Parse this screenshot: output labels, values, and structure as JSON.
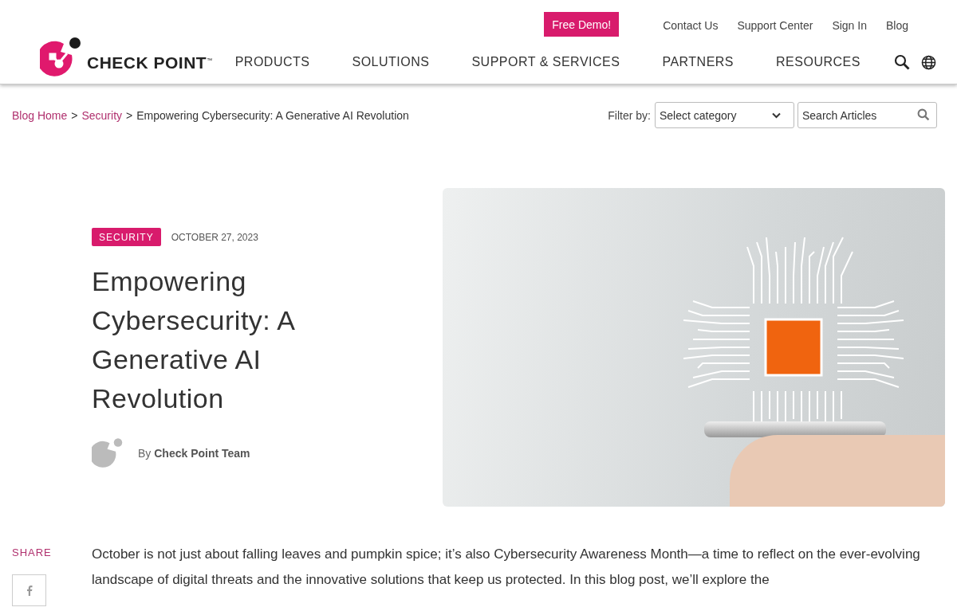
{
  "header": {
    "logo": "CHECK POINT$^{™}$",
    "demo_button": "Free Demo!",
    "top_links": [
      "Contact Us",
      "Support Center",
      "Sign In",
      "Blog"
    ],
    "nav": [
      "PRODUCTS",
      "SOLUTIONS",
      "SUPPORT & SERVICES",
      "PARTNERS",
      "RESOURCES"
    ]
  },
  "breadcrumb": {
    "separator": ">",
    "items": [
      {
        "label": "Blog Home",
        "link": true
      },
      {
        "label": "Security",
        "link": true
      },
      {
        "label": "Empowering Cybersecurity: A Generative AI Revolution",
        "link": false
      }
    ]
  },
  "filter": {
    "label": "Filter by:",
    "category_placeholder": "Select category",
    "search_placeholder": "Search Articles"
  },
  "article": {
    "category": "SECURITY",
    "date": "OCTOBER 27, 2023",
    "title": "Empowering Cybersecurity: A Generative AI Revolution",
    "byline_prefix": "By",
    "author": "Check Point Team",
    "share_label": "SHARE",
    "body": "October is not just about falling leaves and pumpkin spice; it’s also Cybersecurity Awareness Month—a time to reflect on the ever-evolving landscape of digital threats and the innovative solutions that keep us protected. In this blog post, we’ll explore the"
  }
}
